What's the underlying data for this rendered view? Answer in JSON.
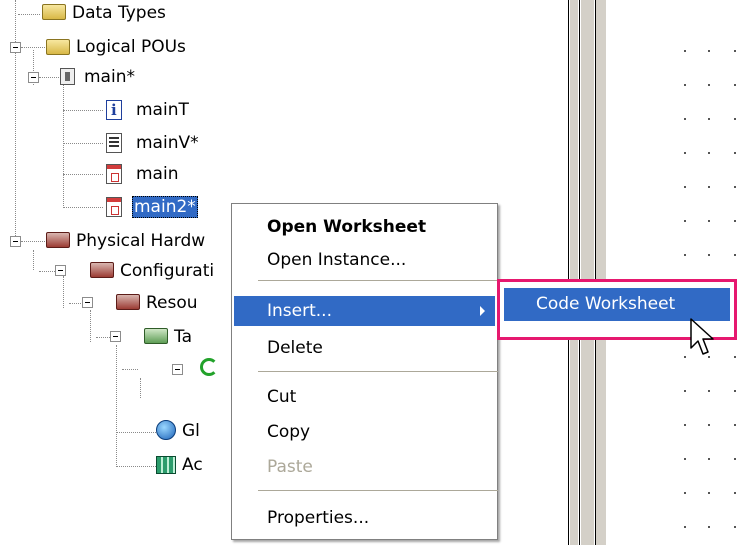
{
  "tree": {
    "items": [
      {
        "label": "Data Types",
        "icon": "folder-icon"
      },
      {
        "label": "Logical POUs",
        "icon": "folder-icon"
      },
      {
        "label": "main*",
        "icon": "program-icon"
      },
      {
        "label": "mainT",
        "icon": "info-doc-icon"
      },
      {
        "label": "mainV*",
        "icon": "variables-doc-icon"
      },
      {
        "label": "main",
        "icon": "code-doc-icon"
      },
      {
        "label": "main2*",
        "icon": "code-doc-icon",
        "selected": true
      },
      {
        "label": "Physical Hardw",
        "icon": "red-folder-icon"
      },
      {
        "label": "Configurati",
        "icon": "red-folder-icon"
      },
      {
        "label": "Resou",
        "icon": "red-folder-icon"
      },
      {
        "label": "Ta",
        "icon": "green-folder-icon"
      },
      {
        "label": "",
        "icon": "task-cycle-icon"
      },
      {
        "label": "Gl",
        "icon": "globals-icon"
      },
      {
        "label": "Ac",
        "icon": "io-grid-icon"
      }
    ]
  },
  "context_menu": {
    "items": [
      {
        "label": "Open Worksheet",
        "bold": true
      },
      {
        "label": "Open Instance..."
      },
      {
        "label": "Insert...",
        "highlighted": true,
        "submenu": true
      },
      {
        "label": "Delete"
      },
      {
        "label": "Cut"
      },
      {
        "label": "Copy"
      },
      {
        "label": "Paste",
        "disabled": true
      },
      {
        "label": "Properties..."
      }
    ]
  },
  "submenu": {
    "items": [
      {
        "label": "Code Worksheet",
        "highlighted": true
      }
    ],
    "highlight_border_color": "#e6186f"
  },
  "colors": {
    "selection": "#316ac5",
    "menu_disabled": "#aca899"
  }
}
